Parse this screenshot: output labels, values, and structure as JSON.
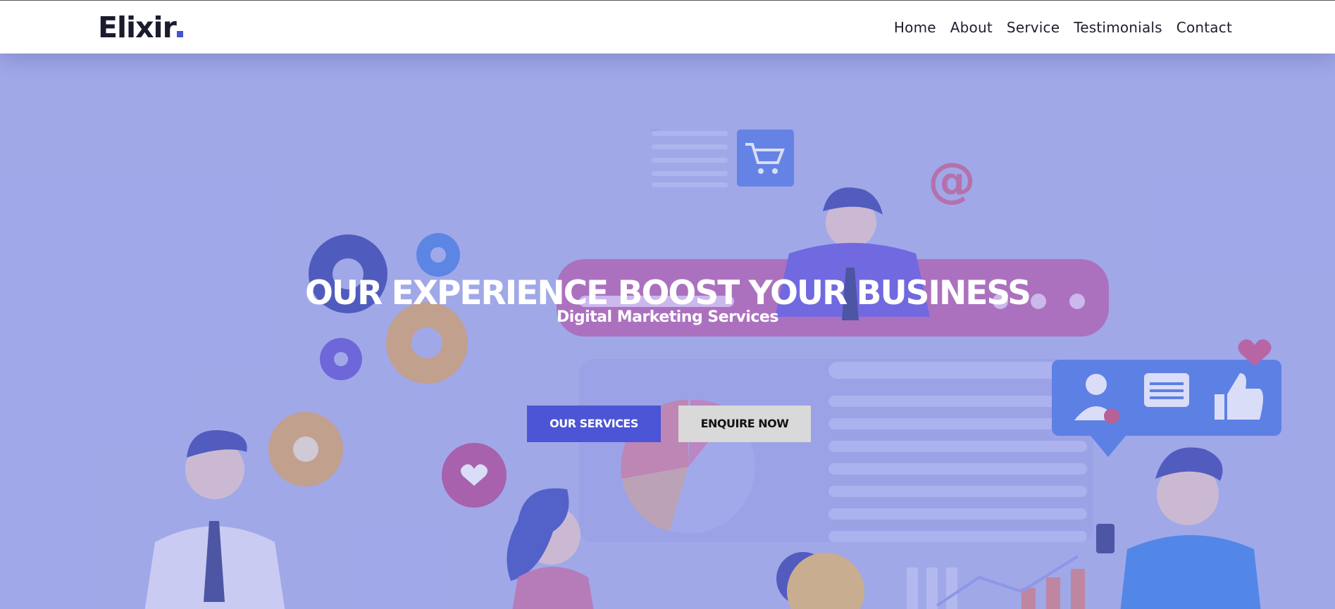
{
  "brand": {
    "name": "Elixir",
    "accent_color": "#4553cf"
  },
  "nav": {
    "items": [
      {
        "label": "Home"
      },
      {
        "label": "About"
      },
      {
        "label": "Service"
      },
      {
        "label": "Testimonials"
      },
      {
        "label": "Contact"
      }
    ]
  },
  "hero": {
    "title": "OUR EXPERIENCE BOOST YOUR BUSINESS",
    "subtitle": "Digital Marketing Services",
    "primary_button": "OUR SERVICES",
    "secondary_button": "ENQUIRE NOW",
    "primary_color": "#4b55d6",
    "illustration_icons": [
      "shopping-cart-icon",
      "at-sign-icon",
      "gear-icon",
      "heart-icon",
      "user-icon",
      "chat-icon",
      "thumbs-up-icon",
      "pie-chart-icon",
      "bar-chart-icon"
    ]
  }
}
